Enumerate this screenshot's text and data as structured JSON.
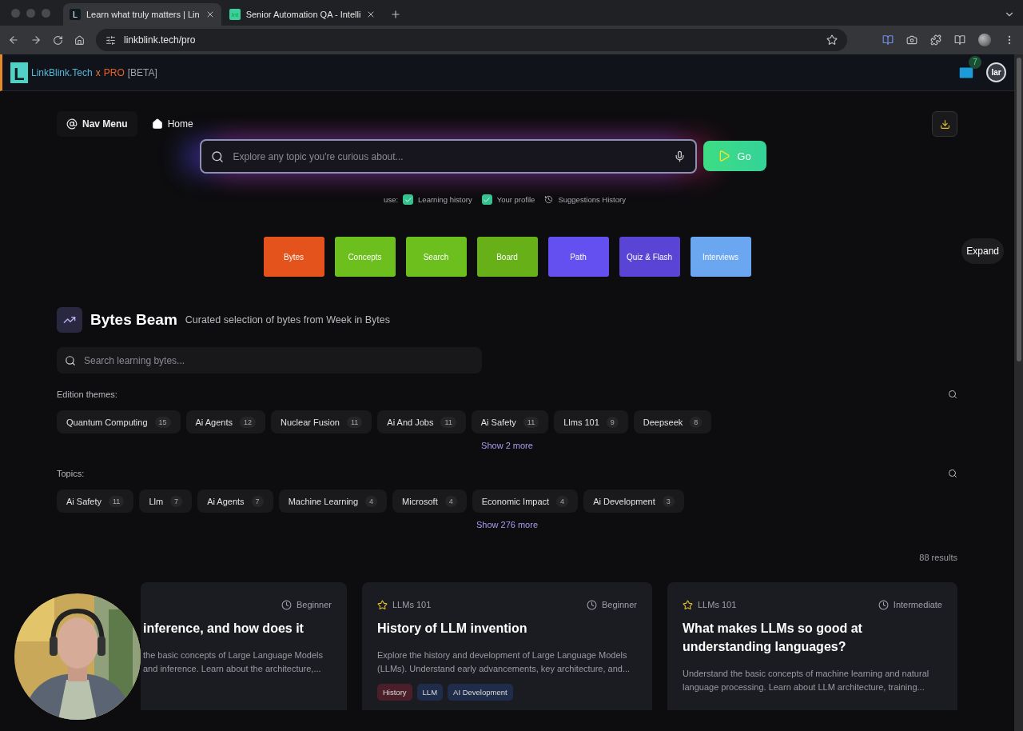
{
  "browser": {
    "tabs": [
      {
        "favicon": "L",
        "title": "Learn what truly matters | Lin",
        "selected": true
      },
      {
        "favicon": "Int",
        "title": "Senior Automation QA - Intelli",
        "selected": false
      }
    ],
    "url": "linkblink.tech/pro"
  },
  "header": {
    "logo_letter": "L",
    "brand": "LinkBlink.Tech",
    "brand_x": "x",
    "brand_pro": "PRO",
    "brand_tag": "[BETA]",
    "mail_count": "7",
    "avatar": "Iar"
  },
  "nav": [
    {
      "kind": "menu",
      "label": "Nav Menu"
    },
    {
      "kind": "home",
      "label": "Home"
    }
  ],
  "search": {
    "placeholder": "Explore any topic you're curious about...",
    "go": "Go"
  },
  "use": {
    "label": "use:",
    "options": [
      {
        "label": "Learning history",
        "checked": true
      },
      {
        "label": "Your profile",
        "checked": true
      }
    ],
    "history": "Suggestions History"
  },
  "modes": [
    {
      "label": "Bytes",
      "color": "#e5531c"
    },
    {
      "label": "Concepts",
      "color": "#6cbf1c"
    },
    {
      "label": "Search",
      "color": "#6cbf1c"
    },
    {
      "label": "Board",
      "color": "#68b018"
    },
    {
      "label": "Path",
      "color": "#6450f0"
    },
    {
      "label": "Quiz & Flash",
      "color": "#5a44d6"
    },
    {
      "label": "Interviews",
      "color": "#6ba6f0"
    }
  ],
  "expand": "Expand",
  "beam": {
    "title": "Bytes Beam",
    "subtitle": "Curated selection of bytes from Week in Bytes",
    "search_placeholder": "Search learning bytes...",
    "groups": [
      {
        "label": "Edition themes:",
        "more": "Show 2 more",
        "chips": [
          {
            "label": "Quantum Computing",
            "count": "15"
          },
          {
            "label": "Ai Agents",
            "count": "12"
          },
          {
            "label": "Nuclear Fusion",
            "count": "11"
          },
          {
            "label": "Ai And Jobs",
            "count": "11"
          },
          {
            "label": "Ai Safety",
            "count": "11"
          },
          {
            "label": "Llms 101",
            "count": "9"
          },
          {
            "label": "Deepseek",
            "count": "8"
          }
        ]
      },
      {
        "label": "Topics:",
        "more": "Show 276 more",
        "chips": [
          {
            "label": "Ai Safety",
            "count": "11"
          },
          {
            "label": "Llm",
            "count": "7"
          },
          {
            "label": "Ai Agents",
            "count": "7"
          },
          {
            "label": "Machine Learning",
            "count": "4"
          },
          {
            "label": "Microsoft",
            "count": "4"
          },
          {
            "label": "Economic Impact",
            "count": "4"
          },
          {
            "label": "Ai Development",
            "count": "3"
          }
        ]
      }
    ]
  },
  "results": "88 results",
  "cards": [
    {
      "level": "Beginner",
      "title": "inference, and how does it",
      "description": "the basic concepts of Large Language Models and inference. Learn about the architecture,..."
    },
    {
      "topic": "LLMs 101",
      "level": "Beginner",
      "title": "History of LLM invention",
      "description": "Explore the history and development of Large Language Models (LLMs). Understand early advancements, key architecture, and...",
      "tags": [
        {
          "label": "History",
          "color": "#4a1f2a"
        },
        {
          "label": "LLM",
          "color": "#1f2d4a"
        },
        {
          "label": "AI Development",
          "color": "#1f2d4a"
        }
      ]
    },
    {
      "topic": "LLMs 101",
      "level": "Intermediate",
      "title": "What makes LLMs so good at understanding languages?",
      "description": "Understand the basic concepts of machine learning and natural language processing. Learn about LLM architecture, training..."
    }
  ]
}
